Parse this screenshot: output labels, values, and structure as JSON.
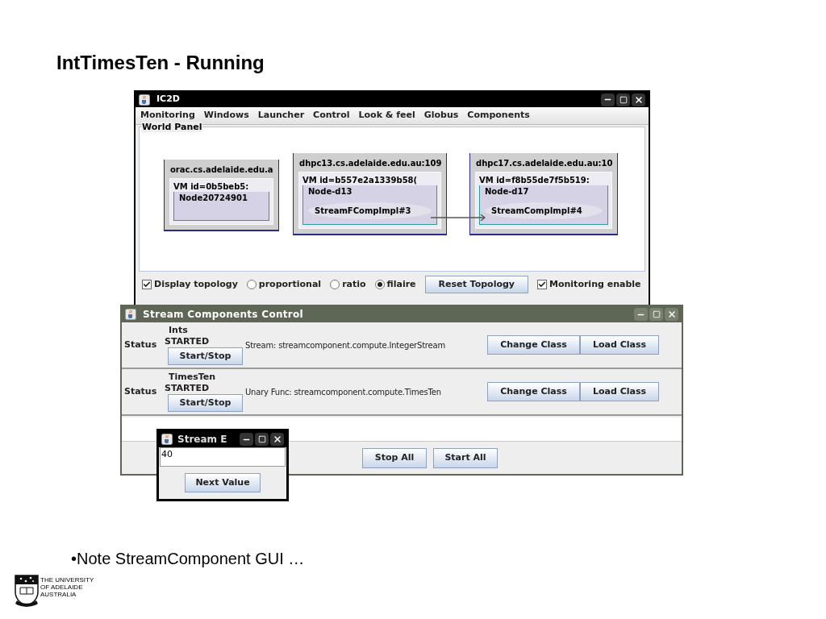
{
  "slide_title": "IntTimesTen - Running",
  "ic2d": {
    "title": "IC2D",
    "menu": [
      "Monitoring",
      "Windows",
      "Launcher",
      "Control",
      "Look & feel",
      "Globus",
      "Components"
    ],
    "world_panel": {
      "title": "World Panel",
      "hosts": [
        {
          "name": "orac.cs.adelaide.edu.a",
          "vm": "VM id=0b5beb5:",
          "node": "Node20724901"
        },
        {
          "name": "dhpc13.cs.adelaide.edu.au:109",
          "vm": "VM id=b557e2a1339b58(",
          "node": "Node-d13",
          "components": [
            "StreamFCompImpl#3"
          ]
        },
        {
          "name": "dhpc17.cs.adelaide.edu.au:10",
          "vm": "VM id=f8b55de7f5b519:",
          "node": "Node-d17",
          "components": [
            "StreamCompImpl#4"
          ]
        }
      ]
    },
    "controls": [
      {
        "kind": "checkbox",
        "label": "Display topology",
        "checked": true
      },
      {
        "kind": "radio",
        "label": "proportional",
        "selected": false
      },
      {
        "kind": "radio",
        "label": "ratio",
        "selected": false
      },
      {
        "kind": "radio",
        "label": "filaire",
        "selected": true
      },
      {
        "kind": "button",
        "label": "Reset Topology"
      },
      {
        "kind": "checkbox",
        "label": "Monitoring enable",
        "checked": true
      }
    ]
  },
  "stream_control": {
    "title": "Stream Components Control",
    "rows": [
      {
        "status_label": "Status",
        "name": "Ints",
        "state": "STARTED",
        "toggle": "Start/Stop",
        "description": "Stream: streamcomponent.compute.IntegerStream",
        "buttons": [
          "Change Class",
          "Load Class"
        ]
      },
      {
        "status_label": "Status",
        "name": "TimesTen",
        "state": "STARTED",
        "toggle": "Start/Stop",
        "description": "Unary Func: streamcomponent.compute.TimesTen",
        "buttons": [
          "Change Class",
          "Load Class"
        ]
      }
    ],
    "buttons": [
      "Stop All",
      "Start All"
    ]
  },
  "stream_window": {
    "title": "Stream E",
    "value": "40",
    "button": "Next Value"
  },
  "note": "•Note StreamComponent GUI …",
  "logo": {
    "lines": [
      "THE UNIVERSITY",
      "OF ADELAIDE",
      "AUSTRALIA"
    ]
  }
}
